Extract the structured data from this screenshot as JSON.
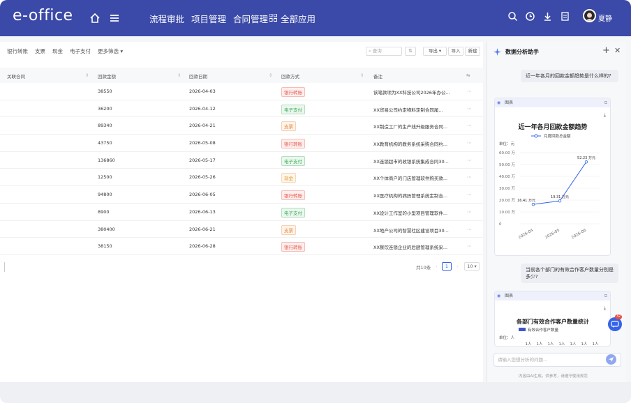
{
  "header": {
    "logo": "e-office",
    "nav": [
      "流程审批",
      "项目管理",
      "合同管理"
    ],
    "all_apps": "全部应用",
    "user_name": "夏静"
  },
  "toolbar": {
    "filters": [
      "银行转账",
      "支票",
      "现金",
      "电子支付",
      "更多筛选"
    ],
    "search_placeholder": "查询",
    "export_label": "导出",
    "import_label": "导入",
    "new_label": "新建"
  },
  "table": {
    "columns": [
      "关联合同",
      "回款金额",
      "回款日期",
      "回款方式",
      "备注"
    ],
    "rows": [
      {
        "amount": "38550",
        "date": "2026-04-03",
        "method": "银行转账",
        "note": "该笔款项为XX科技公司2026年办公..."
      },
      {
        "amount": "36200",
        "date": "2026-04-12",
        "method": "电子支付",
        "note": "XX贸易公司约定物料定制合同尾..."
      },
      {
        "amount": "89340",
        "date": "2026-04-21",
        "method": "支票",
        "note": "XX制造工厂的生产线升级服务合同..."
      },
      {
        "amount": "43750",
        "date": "2026-05-08",
        "method": "银行转账",
        "note": "XX教育机构的教务系统采购合同约..."
      },
      {
        "amount": "136860",
        "date": "2026-05-17",
        "method": "电子支付",
        "note": "XX连锁超市的收银系统集成合同30..."
      },
      {
        "amount": "12500",
        "date": "2026-05-26",
        "method": "现金",
        "note": "XX个体商户的门店管理软件购买款..."
      },
      {
        "amount": "94800",
        "date": "2026-06-05",
        "method": "银行转账",
        "note": "XX医疗机构的病历管理系统定制合..."
      },
      {
        "amount": "8900",
        "date": "2026-06-13",
        "method": "电子支付",
        "note": "XX设计工作室的小型项目管理软件..."
      },
      {
        "amount": "380400",
        "date": "2026-06-21",
        "method": "支票",
        "note": "XX地产公司的智慧社区建设项目30..."
      },
      {
        "amount": "38150",
        "date": "2026-06-28",
        "method": "银行转账",
        "note": "XX餐饮连锁企业的后厨管理系统采..."
      }
    ]
  },
  "pager": {
    "total": "共10条",
    "page": "1",
    "size": "10"
  },
  "side": {
    "title": "数据分析助手",
    "q1": "近一年各月的回款金额趋势是什么样的?",
    "card_label": "图表",
    "q2": "当前各个部门的有效合作客户数量分别是多少?",
    "input_placeholder": "请输入您想分析的问题...",
    "disclaimer": "内容由AI生成，供参考，请遵守使用规范",
    "fab_badge": "32"
  },
  "colors": {
    "header": "#3b4aa8",
    "bank": "#e8594a",
    "epay": "#3fae5c",
    "check": "#e88a3a",
    "cash": "#e8a13a",
    "line": "#3563e9"
  },
  "chart_data": [
    {
      "type": "line",
      "title": "近一年各月回款金额趋势",
      "unit": "单位：元",
      "legend": "月度回款总金额",
      "categories": [
        "2026-04",
        "2026-05",
        "2026-06"
      ],
      "values": [
        16.41,
        19.31,
        52.23
      ],
      "value_labels": [
        "16.41 万元",
        "19.31 万元",
        "52.23 万元"
      ],
      "y_ticks": [
        "0",
        "10.00 万",
        "20.00 万",
        "30.00 万",
        "40.00 万",
        "50.00 万",
        "60.00 万"
      ],
      "ylim": [
        0,
        60
      ]
    },
    {
      "type": "bar",
      "title": "各部门有效合作客户数量统计",
      "unit": "单位：人",
      "legend": "有效合作客户数量",
      "labels": [
        "1人",
        "1人",
        "1人",
        "1人",
        "1人",
        "1人",
        "1人"
      ]
    }
  ]
}
